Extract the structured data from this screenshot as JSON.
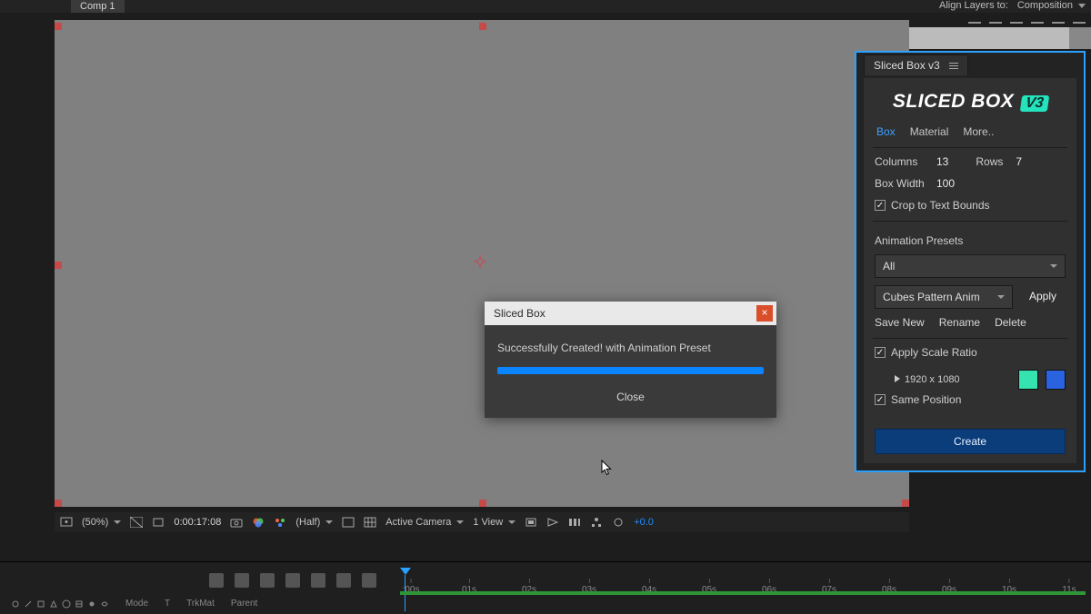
{
  "tab": {
    "label": "Comp 1"
  },
  "align": {
    "label": "Align Layers to:",
    "target": "Composition"
  },
  "dialog": {
    "title": "Sliced Box",
    "message": "Successfully Created! with Animation Preset",
    "close": "Close",
    "progress_pct": 100
  },
  "viewer_footer": {
    "magnification": "(50%)",
    "timecode": "0:00:17:08",
    "resolution": "(Half)",
    "camera": "Active Camera",
    "views": "1 View",
    "exposure": "+0.0"
  },
  "timeline": {
    "cols": {
      "mode": "Mode",
      "trkmat": "TrkMat",
      "t": "T",
      "parent": "Parent"
    },
    "ticks": [
      ":00s",
      "01s",
      "02s",
      "03s",
      "04s",
      "05s",
      "06s",
      "07s",
      "08s",
      "09s",
      "10s",
      "11s"
    ]
  },
  "panel": {
    "tab_label": "Sliced Box v3",
    "logo_text": "SLICED BOX",
    "logo_badge": "V3",
    "tabs": {
      "box": "Box",
      "material": "Material",
      "more": "More.."
    },
    "grid": {
      "columns_label": "Columns",
      "columns_value": "13",
      "rows_label": "Rows",
      "rows_value": "7",
      "boxwidth_label": "Box Width",
      "boxwidth_value": "100",
      "crop_label": "Crop to Text Bounds"
    },
    "presets": {
      "header": "Animation Presets",
      "filter": "All",
      "selected": "Cubes Pattern Anim",
      "apply": "Apply",
      "save_new": "Save New",
      "rename": "Rename",
      "delete": "Delete"
    },
    "options": {
      "apply_scale_ratio": "Apply Scale Ratio",
      "resolution": "1920 x 1080",
      "same_position": "Same Position",
      "swatch1": "#34e3b0",
      "swatch2": "#2a63e0"
    },
    "create": "Create"
  }
}
